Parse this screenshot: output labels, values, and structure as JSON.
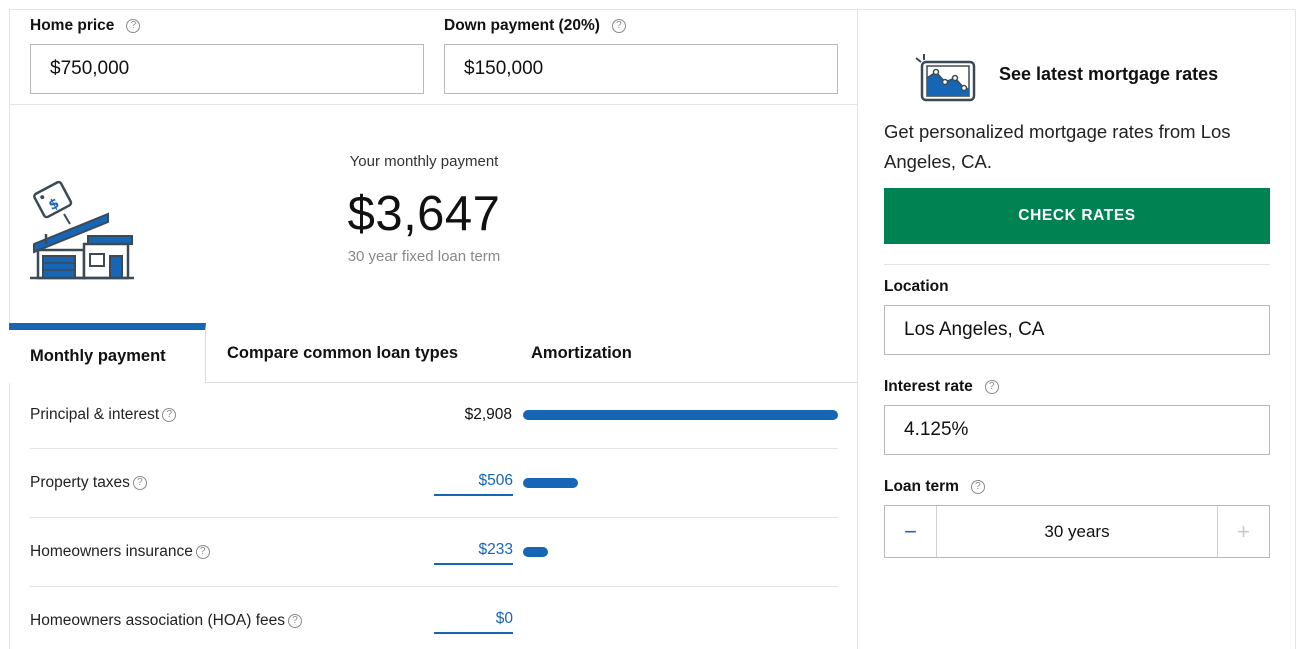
{
  "home_price": {
    "label": "Home price",
    "value": "$750,000"
  },
  "down_payment": {
    "label": "Down payment (20%)",
    "value": "$150,000"
  },
  "summary": {
    "caption": "Your monthly payment",
    "amount": "$3,647",
    "term": "30 year fixed loan term"
  },
  "tabs": [
    {
      "label": "Monthly payment",
      "active": true
    },
    {
      "label": "Compare common loan types",
      "active": false
    },
    {
      "label": "Amortization",
      "active": false
    }
  ],
  "breakdown": [
    {
      "label": "Principal & interest",
      "value": "$2,908",
      "editable": false,
      "share": 1.0
    },
    {
      "label": "Property taxes",
      "value": "$506",
      "editable": true,
      "share": 0.174
    },
    {
      "label": "Homeowners insurance",
      "value": "$233",
      "editable": true,
      "share": 0.08
    },
    {
      "label": "Homeowners association (HOA) fees",
      "value": "$0",
      "editable": true,
      "share": 0
    }
  ],
  "rates_panel": {
    "title": "See latest mortgage rates",
    "description": "Get personalized mortgage rates from Los Angeles, CA.",
    "button": "CHECK RATES"
  },
  "location": {
    "label": "Location",
    "value": "Los Angeles, CA"
  },
  "interest_rate": {
    "label": "Interest rate",
    "value": "4.125%"
  },
  "loan_term": {
    "label": "Loan term",
    "value": "30 years",
    "minus": "−",
    "plus": "+"
  },
  "help_glyph": "?",
  "colors": {
    "accent": "#1765b5",
    "button": "#008253",
    "divider": "#e4e4e4"
  },
  "icons": [
    "help-icon",
    "house-price-tag-illustration",
    "tablet-chart-icon",
    "minus-icon",
    "plus-icon"
  ]
}
